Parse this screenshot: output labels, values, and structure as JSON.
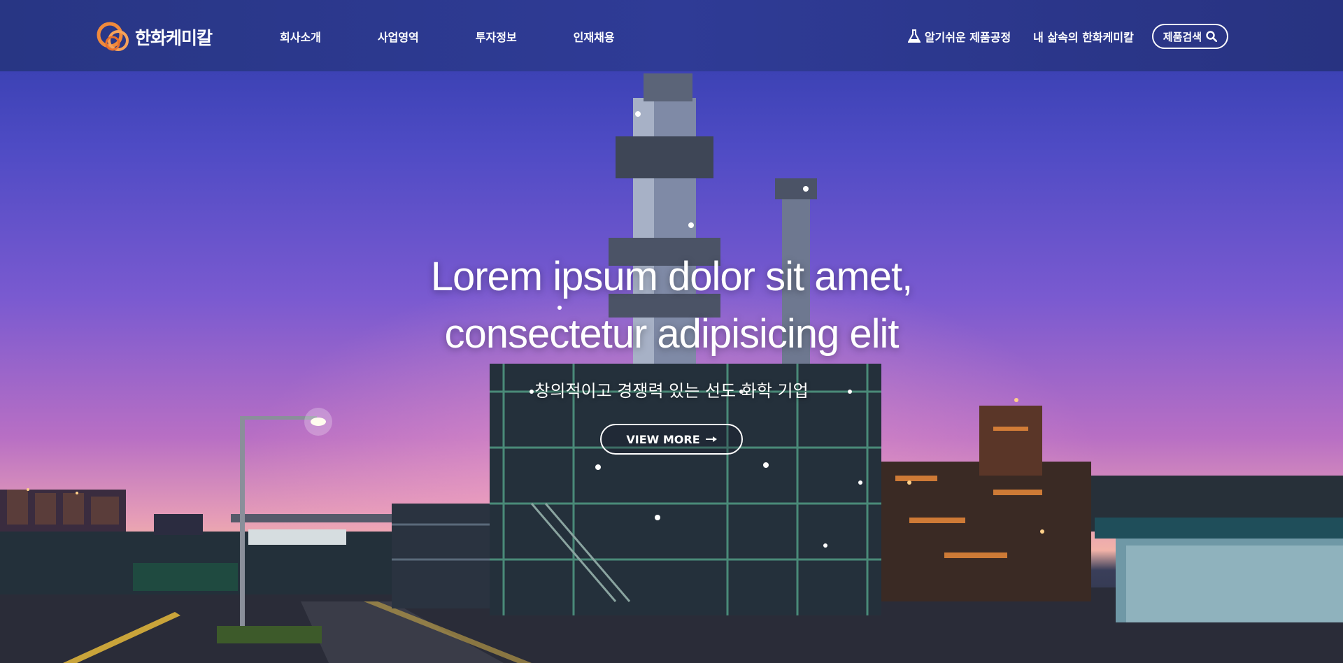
{
  "header": {
    "logo_text": "한화케미칼",
    "nav": [
      "회사소개",
      "사업영역",
      "투자정보",
      "인재채용"
    ],
    "util": {
      "process_label": "알기쉬운 제품공정",
      "life_label": "내 삶속의 한화케미칼",
      "search_label": "제품검색"
    }
  },
  "hero": {
    "title_line1": "Lorem ipsum dolor sit amet,",
    "title_line2": "consectetur adipisicing elit",
    "subtitle": "창의적이고 경쟁력 있는 선도 화학 기업",
    "button_label": "VIEW MORE"
  },
  "icons": [
    "logo-mark",
    "flask-icon",
    "search-icon",
    "arrow-right-icon"
  ],
  "colors": {
    "header_bg": "#2f3b96",
    "logo_orange": "#f08a3c",
    "text": "#ffffff"
  }
}
